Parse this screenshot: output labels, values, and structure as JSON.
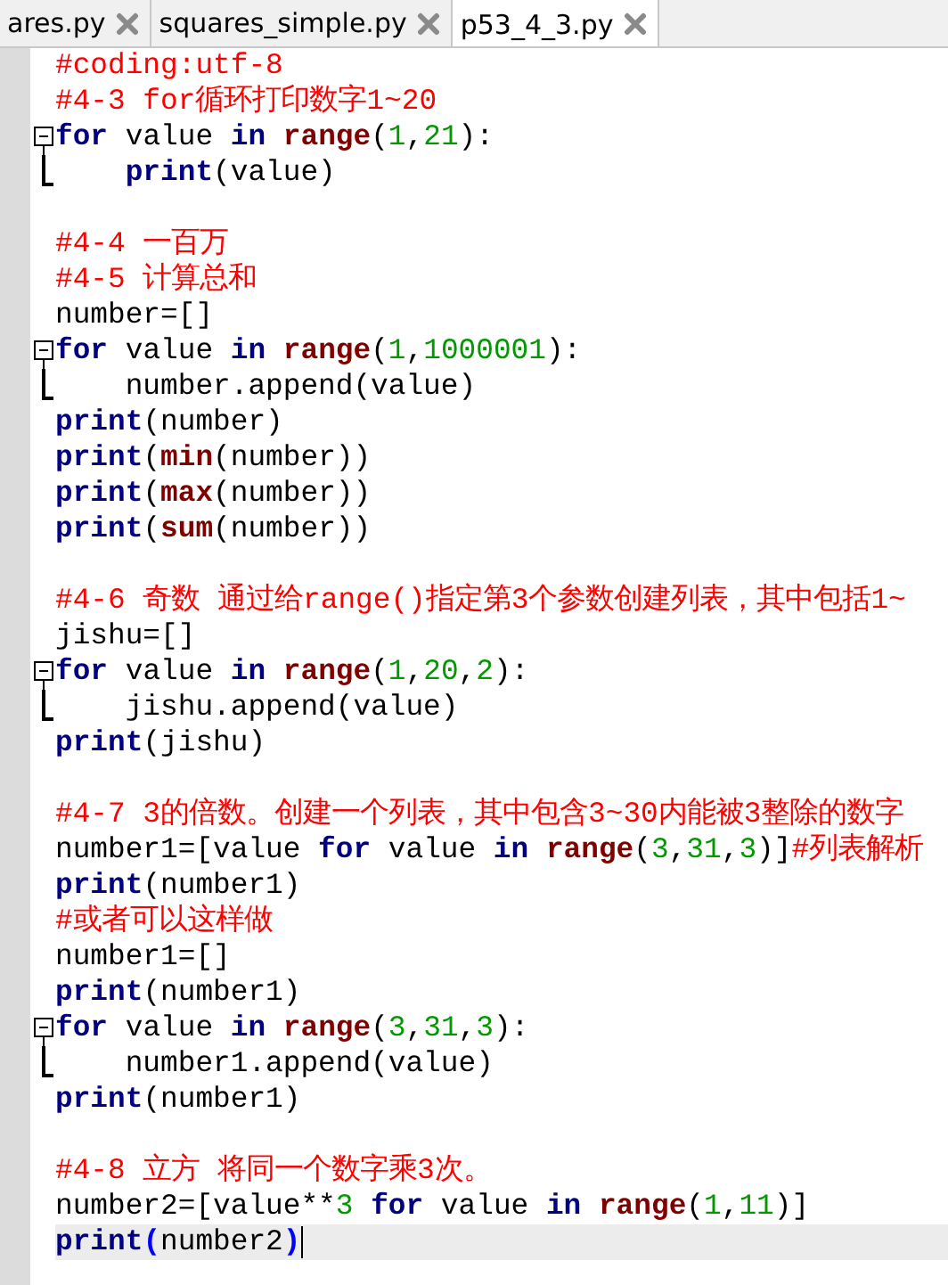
{
  "tabs": [
    {
      "label": "ares.py",
      "selected": false
    },
    {
      "label": "squares_simple.py",
      "selected": false
    },
    {
      "label": "p53_4_3.py",
      "selected": true
    }
  ],
  "editor": {
    "lines": [
      {
        "current": false,
        "tokens": [
          {
            "kind": "comment",
            "text": "#coding:utf-8"
          }
        ]
      },
      {
        "current": false,
        "tokens": [
          {
            "kind": "comment",
            "text": "#4-3 for循环打印数字1~20"
          }
        ]
      },
      {
        "current": false,
        "fold_start": true,
        "tokens": [
          {
            "kind": "keyword",
            "text": "for"
          },
          {
            "kind": "text",
            "text": " value "
          },
          {
            "kind": "keyword",
            "text": "in "
          },
          {
            "kind": "function",
            "text": "range"
          },
          {
            "kind": "text",
            "text": "("
          },
          {
            "kind": "number",
            "text": "1"
          },
          {
            "kind": "text",
            "text": ","
          },
          {
            "kind": "number",
            "text": "21"
          },
          {
            "kind": "text",
            "text": "):"
          }
        ]
      },
      {
        "current": false,
        "fold_end": true,
        "tokens": [
          {
            "kind": "keyword",
            "text": "    print"
          },
          {
            "kind": "text",
            "text": "(value)"
          }
        ]
      },
      {
        "current": false
      },
      {
        "current": false,
        "tokens": [
          {
            "kind": "comment",
            "text": "#4-4 一百万"
          }
        ]
      },
      {
        "current": false,
        "tokens": [
          {
            "kind": "comment",
            "text": "#4-5 计算总和"
          }
        ]
      },
      {
        "current": false,
        "tokens": [
          {
            "kind": "text",
            "text": "number=[]"
          }
        ]
      },
      {
        "current": false,
        "fold_start": true,
        "tokens": [
          {
            "kind": "keyword",
            "text": "for"
          },
          {
            "kind": "text",
            "text": " value "
          },
          {
            "kind": "keyword",
            "text": "in "
          },
          {
            "kind": "function",
            "text": "range"
          },
          {
            "kind": "text",
            "text": "("
          },
          {
            "kind": "number",
            "text": "1"
          },
          {
            "kind": "text",
            "text": ","
          },
          {
            "kind": "number",
            "text": "1000001"
          },
          {
            "kind": "text",
            "text": "):"
          }
        ]
      },
      {
        "current": false,
        "fold_end": true,
        "tokens": [
          {
            "kind": "text",
            "text": "    number.append(value)"
          }
        ]
      },
      {
        "current": false,
        "tokens": [
          {
            "kind": "keyword",
            "text": "print"
          },
          {
            "kind": "text",
            "text": "(number)"
          }
        ]
      },
      {
        "current": false,
        "tokens": [
          {
            "kind": "keyword",
            "text": "print"
          },
          {
            "kind": "text",
            "text": "("
          },
          {
            "kind": "function",
            "text": "min"
          },
          {
            "kind": "text",
            "text": "(number))"
          }
        ]
      },
      {
        "current": false,
        "tokens": [
          {
            "kind": "keyword",
            "text": "print"
          },
          {
            "kind": "text",
            "text": "("
          },
          {
            "kind": "function",
            "text": "max"
          },
          {
            "kind": "text",
            "text": "(number))"
          }
        ]
      },
      {
        "current": false,
        "tokens": [
          {
            "kind": "keyword",
            "text": "print"
          },
          {
            "kind": "text",
            "text": "("
          },
          {
            "kind": "function",
            "text": "sum"
          },
          {
            "kind": "text",
            "text": "(number))"
          }
        ]
      },
      {
        "current": false
      },
      {
        "current": false,
        "tokens": [
          {
            "kind": "comment",
            "text": "#4-6 奇数 通过给range()指定第3个参数创建列表，其中包括1~"
          }
        ]
      },
      {
        "current": false,
        "tokens": [
          {
            "kind": "text",
            "text": "jishu=[]"
          }
        ]
      },
      {
        "current": false,
        "fold_start": true,
        "tokens": [
          {
            "kind": "keyword",
            "text": "for"
          },
          {
            "kind": "text",
            "text": " value "
          },
          {
            "kind": "keyword",
            "text": "in "
          },
          {
            "kind": "function",
            "text": "range"
          },
          {
            "kind": "text",
            "text": "("
          },
          {
            "kind": "number",
            "text": "1"
          },
          {
            "kind": "text",
            "text": ","
          },
          {
            "kind": "number",
            "text": "20"
          },
          {
            "kind": "text",
            "text": ","
          },
          {
            "kind": "number",
            "text": "2"
          },
          {
            "kind": "text",
            "text": "):"
          }
        ]
      },
      {
        "current": false,
        "fold_end": true,
        "tokens": [
          {
            "kind": "text",
            "text": "    jishu.append(value)"
          }
        ]
      },
      {
        "current": false,
        "tokens": [
          {
            "kind": "keyword",
            "text": "print"
          },
          {
            "kind": "text",
            "text": "(jishu)"
          }
        ]
      },
      {
        "current": false
      },
      {
        "current": false,
        "tokens": [
          {
            "kind": "comment",
            "text": "#4-7 3的倍数。创建一个列表，其中包含3~30内能被3整除的数字"
          }
        ]
      },
      {
        "current": false,
        "tokens": [
          {
            "kind": "text",
            "text": "number1=[value "
          },
          {
            "kind": "keyword",
            "text": "for"
          },
          {
            "kind": "text",
            "text": " value "
          },
          {
            "kind": "keyword",
            "text": "in "
          },
          {
            "kind": "function",
            "text": "range"
          },
          {
            "kind": "text",
            "text": "("
          },
          {
            "kind": "number",
            "text": "3"
          },
          {
            "kind": "text",
            "text": ","
          },
          {
            "kind": "number",
            "text": "31"
          },
          {
            "kind": "text",
            "text": ","
          },
          {
            "kind": "number",
            "text": "3"
          },
          {
            "kind": "text",
            "text": ")]"
          },
          {
            "kind": "comment",
            "text": "#列表解析"
          }
        ]
      },
      {
        "current": false,
        "tokens": [
          {
            "kind": "keyword",
            "text": "print"
          },
          {
            "kind": "text",
            "text": "(number1)"
          }
        ]
      },
      {
        "current": false,
        "tokens": [
          {
            "kind": "comment",
            "text": "#或者可以这样做"
          }
        ]
      },
      {
        "current": false,
        "tokens": [
          {
            "kind": "text",
            "text": "number1=[]"
          }
        ]
      },
      {
        "current": false,
        "tokens": [
          {
            "kind": "keyword",
            "text": "print"
          },
          {
            "kind": "text",
            "text": "(number1)"
          }
        ]
      },
      {
        "current": false,
        "fold_start": true,
        "tokens": [
          {
            "kind": "keyword",
            "text": "for"
          },
          {
            "kind": "text",
            "text": " value "
          },
          {
            "kind": "keyword",
            "text": "in "
          },
          {
            "kind": "function",
            "text": "range"
          },
          {
            "kind": "text",
            "text": "("
          },
          {
            "kind": "number",
            "text": "3"
          },
          {
            "kind": "text",
            "text": ","
          },
          {
            "kind": "number",
            "text": "31"
          },
          {
            "kind": "text",
            "text": ","
          },
          {
            "kind": "number",
            "text": "3"
          },
          {
            "kind": "text",
            "text": "):"
          }
        ]
      },
      {
        "current": false,
        "fold_end": true,
        "tokens": [
          {
            "kind": "text",
            "text": "    number1.append(value)"
          }
        ]
      },
      {
        "current": false,
        "tokens": [
          {
            "kind": "keyword",
            "text": "print"
          },
          {
            "kind": "text",
            "text": "(number1)"
          }
        ]
      },
      {
        "current": false
      },
      {
        "current": false,
        "tokens": [
          {
            "kind": "comment",
            "text": "#4-8 立方 将同一个数字乘3次。"
          }
        ]
      },
      {
        "current": false,
        "tokens": [
          {
            "kind": "text",
            "text": "number2=[value**"
          },
          {
            "kind": "number",
            "text": "3 "
          },
          {
            "kind": "keyword",
            "text": "for"
          },
          {
            "kind": "text",
            "text": " value "
          },
          {
            "kind": "keyword",
            "text": "in "
          },
          {
            "kind": "function",
            "text": "range"
          },
          {
            "kind": "text",
            "text": "("
          },
          {
            "kind": "number",
            "text": "1"
          },
          {
            "kind": "text",
            "text": ","
          },
          {
            "kind": "number",
            "text": "11"
          },
          {
            "kind": "text",
            "text": ")]"
          }
        ]
      },
      {
        "current": true,
        "tokens": [
          {
            "kind": "keyword",
            "text": "print"
          },
          {
            "kind": "brace",
            "text": "("
          },
          {
            "kind": "text",
            "text": "number2"
          },
          {
            "kind": "brace",
            "text": ")"
          }
        ]
      }
    ]
  }
}
